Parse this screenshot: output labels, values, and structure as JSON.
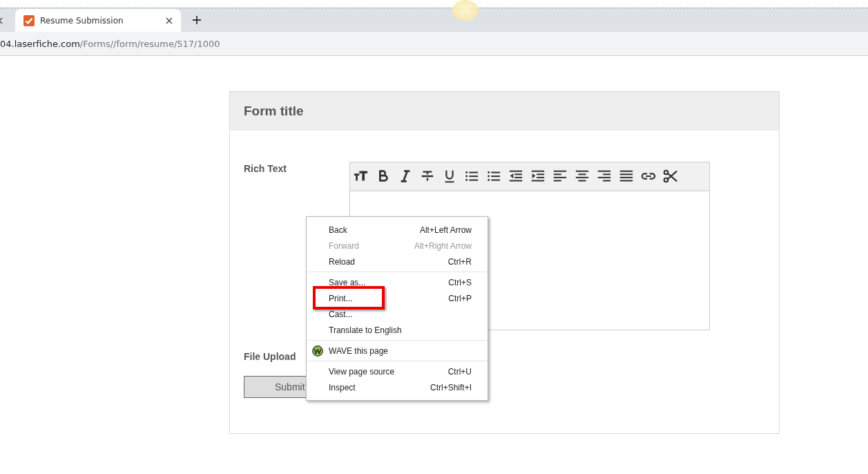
{
  "browser": {
    "tabs": [
      {
        "selected": false
      },
      {
        "title": "Resume Submission",
        "selected": true
      }
    ],
    "address": {
      "host": "04.laserfiche.com",
      "path": "/Forms//form/resume/517/1000"
    }
  },
  "form": {
    "title": "Form title",
    "fields": [
      {
        "kind": "richtext",
        "label": "Rich Text"
      },
      {
        "kind": "file",
        "label": "File Upload"
      }
    ],
    "submit": "Submit"
  },
  "context_menu": {
    "groups": [
      [
        {
          "kind": "command",
          "label": "Back",
          "shortcut": "Alt+Left Arrow",
          "disabled": false,
          "highlighted": false
        },
        {
          "kind": "command",
          "label": "Forward",
          "shortcut": "Alt+Right Arrow",
          "disabled": true,
          "highlighted": false
        },
        {
          "kind": "command",
          "label": "Reload",
          "shortcut": "Ctrl+R",
          "disabled": false,
          "highlighted": false
        }
      ],
      [
        {
          "kind": "command",
          "label": "Save as...",
          "shortcut": "Ctrl+S",
          "disabled": false,
          "highlighted": false
        },
        {
          "kind": "command",
          "label": "Print...",
          "shortcut": "Ctrl+P",
          "disabled": false,
          "highlighted": true
        },
        {
          "kind": "command",
          "label": "Cast...",
          "disabled": false,
          "highlighted": false
        },
        {
          "kind": "command",
          "label": "Translate to English",
          "disabled": false,
          "highlighted": false
        }
      ],
      [
        {
          "kind": "extension",
          "label": "WAVE this page",
          "disabled": false,
          "highlighted": false
        }
      ],
      [
        {
          "kind": "command",
          "label": "View page source",
          "shortcut": "Ctrl+U",
          "disabled": false,
          "highlighted": false
        },
        {
          "kind": "command",
          "label": "Inspect",
          "shortcut": "Ctrl+Shift+I",
          "disabled": false,
          "highlighted": false
        }
      ]
    ]
  }
}
